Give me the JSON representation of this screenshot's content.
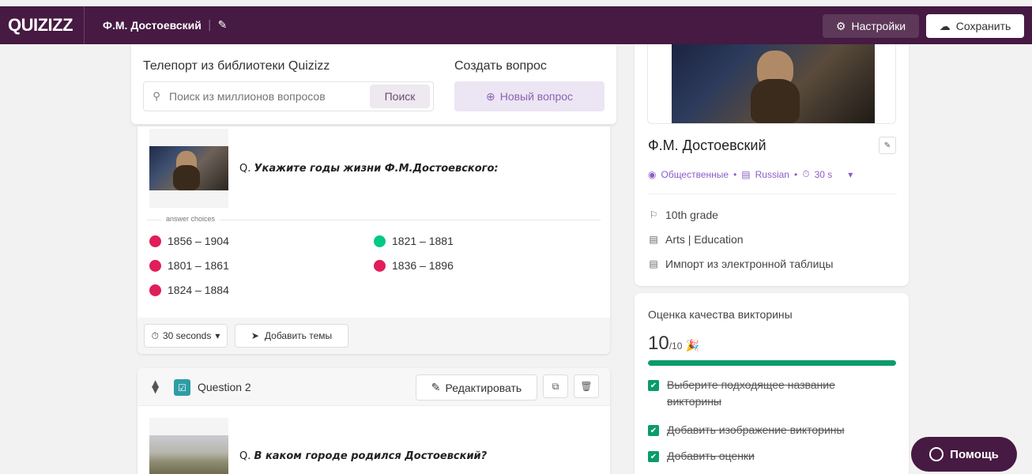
{
  "app": {
    "logo": "QUIZIZZ",
    "quiz_title": "Ф.М. Достоевский",
    "settings_label": "Настройки",
    "save_label": "Сохранить"
  },
  "teleport": {
    "library_label": "Телепорт из библиотеки Quizizz",
    "search_placeholder": "Поиск из миллионов вопросов",
    "search_button": "Поиск",
    "create_label": "Создать вопрос",
    "new_question_button": "Новый вопрос"
  },
  "question1": {
    "prefix": "Q.",
    "text": "Укажите годы жизни Ф.М.Достоевского:",
    "answer_choices_label": "answer choices",
    "answers": [
      {
        "text": "1856 – 1904",
        "correct": false
      },
      {
        "text": "1821 – 1881",
        "correct": true
      },
      {
        "text": "1801 – 1861",
        "correct": false
      },
      {
        "text": "1836 – 1896",
        "correct": false
      },
      {
        "text": "1824 – 1884",
        "correct": false
      }
    ],
    "time_label": "30 seconds",
    "topics_label": "Добавить темы"
  },
  "question2": {
    "title": "Question 2",
    "edit_label": "Редактировать",
    "prefix": "Q.",
    "text": "В каком городе родился Достоевский?"
  },
  "info": {
    "title": "Ф.М. Достоевский",
    "visibility": "Общественные",
    "language": "Russian",
    "time": "30 s",
    "grade": "10th grade",
    "subject": "Arts | Education",
    "import_label": "Импорт из электронной таблицы"
  },
  "quality": {
    "heading": "Оценка качества викторины",
    "score": "10",
    "score_max": "/10",
    "progress": 1.0,
    "checks": [
      "Выберите подходящее название викторины",
      "Добавить изображение викторины",
      "Добавить оценки"
    ]
  },
  "help_label": "Помощь",
  "colors": {
    "brand": "#461a42",
    "correct": "#00c985",
    "incorrect": "#e01e5a",
    "success": "#0b9b6b",
    "accent": "#8b5cc7"
  }
}
